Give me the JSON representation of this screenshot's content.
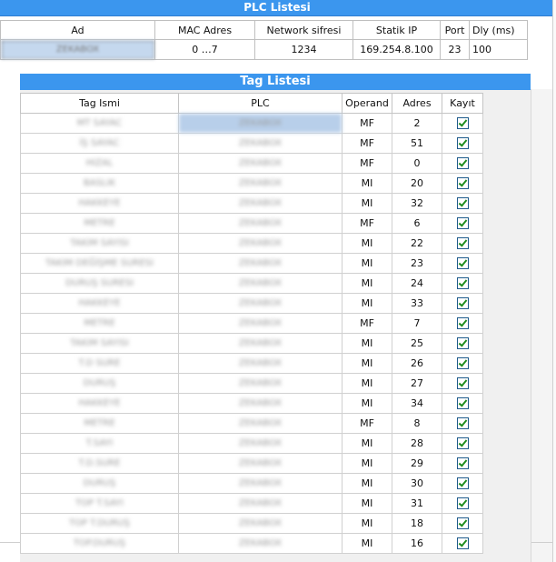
{
  "plc_list": {
    "title": "PLC Listesi",
    "columns": [
      "Ad",
      "MAC Adres",
      "Network sifresi",
      "Statik IP",
      "Port",
      "Dly (ms)"
    ],
    "rows": [
      {
        "ad": "ZEKABOX",
        "mac": "0 …7",
        "network": "1234",
        "ip": "169.254.8.100",
        "port": "23",
        "dly": "100"
      }
    ]
  },
  "tag_list": {
    "title": "Tag Listesi",
    "columns": [
      "Tag Ismi",
      "PLC",
      "Operand",
      "Adres",
      "Kayıt"
    ],
    "rows": [
      {
        "name": "MT SAYAC",
        "plc": "ZEKABOX",
        "operand": "MF",
        "adres": "2",
        "kayit": true
      },
      {
        "name": "İŞ SAYAC",
        "plc": "ZEKABOX",
        "operand": "MF",
        "adres": "51",
        "kayit": true
      },
      {
        "name": "HIZAL",
        "plc": "ZEKABOX",
        "operand": "MF",
        "adres": "0",
        "kayit": true
      },
      {
        "name": "BASLIK",
        "plc": "ZEKABOX",
        "operand": "MI",
        "adres": "20",
        "kayit": true
      },
      {
        "name": "HAKKEYE",
        "plc": "ZEKABOX",
        "operand": "MI",
        "adres": "32",
        "kayit": true
      },
      {
        "name": "METRE",
        "plc": "ZEKABOX",
        "operand": "MF",
        "adres": "6",
        "kayit": true
      },
      {
        "name": "TAKIM SAYISI",
        "plc": "ZEKABOX",
        "operand": "MI",
        "adres": "22",
        "kayit": true
      },
      {
        "name": "TAKIM DEĞİŞME SURESI",
        "plc": "ZEKABOX",
        "operand": "MI",
        "adres": "23",
        "kayit": true
      },
      {
        "name": "DURUŞ SURESI",
        "plc": "ZEKABOX",
        "operand": "MI",
        "adres": "24",
        "kayit": true
      },
      {
        "name": "HAKKEYE",
        "plc": "ZEKABOX",
        "operand": "MI",
        "adres": "33",
        "kayit": true
      },
      {
        "name": "METRE",
        "plc": "ZEKABOX",
        "operand": "MF",
        "adres": "7",
        "kayit": true
      },
      {
        "name": "TAKIM SAYISI",
        "plc": "ZEKABOX",
        "operand": "MI",
        "adres": "25",
        "kayit": true
      },
      {
        "name": "T.D SURE",
        "plc": "ZEKABOX",
        "operand": "MI",
        "adres": "26",
        "kayit": true
      },
      {
        "name": "DURUŞ",
        "plc": "ZEKABOX",
        "operand": "MI",
        "adres": "27",
        "kayit": true
      },
      {
        "name": "HAKKEYE",
        "plc": "ZEKABOX",
        "operand": "MI",
        "adres": "34",
        "kayit": true
      },
      {
        "name": "METRE",
        "plc": "ZEKABOX",
        "operand": "MF",
        "adres": "8",
        "kayit": true
      },
      {
        "name": "T.SAYI",
        "plc": "ZEKABOX",
        "operand": "MI",
        "adres": "28",
        "kayit": true
      },
      {
        "name": "T.D.SURE",
        "plc": "ZEKABOX",
        "operand": "MI",
        "adres": "29",
        "kayit": true
      },
      {
        "name": "DURUŞ",
        "plc": "ZEKABOX",
        "operand": "MI",
        "adres": "30",
        "kayit": true
      },
      {
        "name": "TOP T.SAYI",
        "plc": "ZEKABOX",
        "operand": "MI",
        "adres": "31",
        "kayit": true
      },
      {
        "name": "TOP T.DURUŞ",
        "plc": "ZEKABOX",
        "operand": "MI",
        "adres": "18",
        "kayit": true
      },
      {
        "name": "TOP.DURUŞ",
        "plc": "ZEKABOX",
        "operand": "MI",
        "adres": "16",
        "kayit": true
      }
    ]
  }
}
